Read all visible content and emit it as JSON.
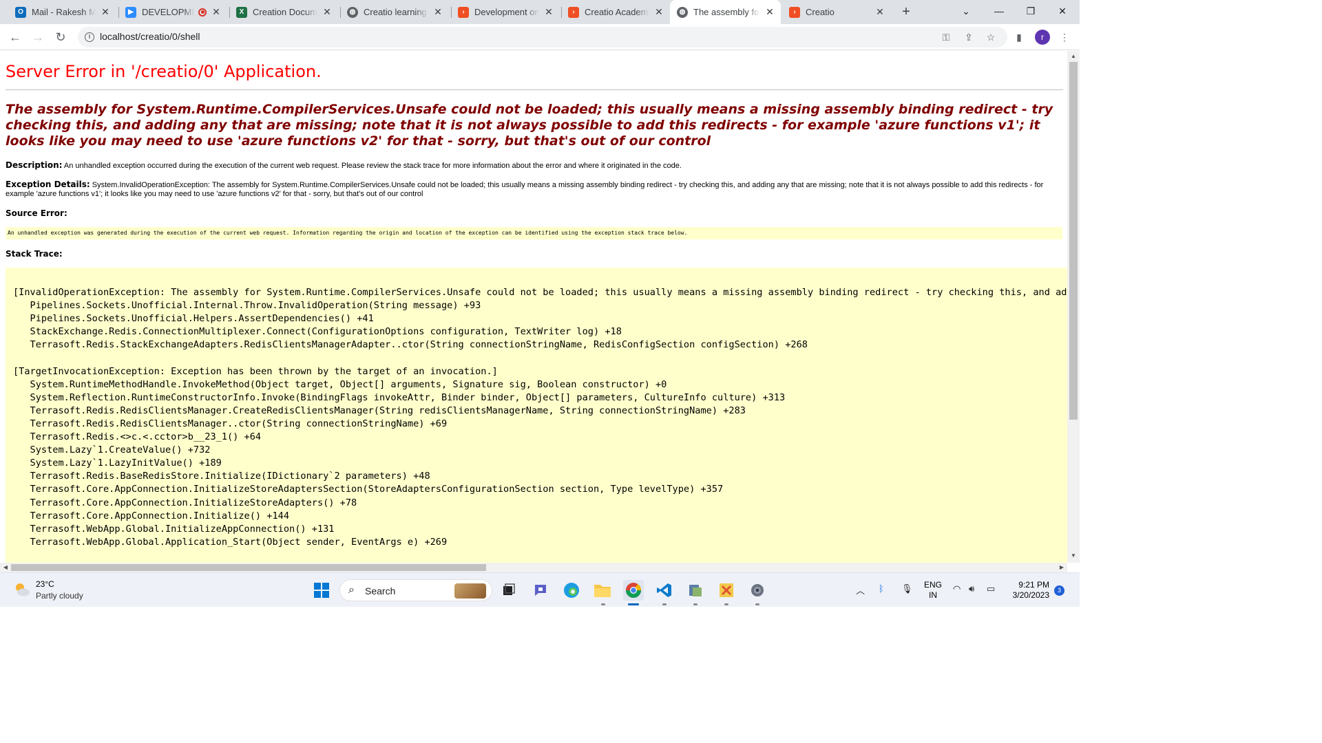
{
  "browser": {
    "tabs": [
      {
        "title": "Mail - Rakesh Mali - Outlook",
        "icon": "outlook-icon",
        "color": "#0f6cbd"
      },
      {
        "title": "DEVELOPMENT",
        "icon": "zoom-icon",
        "color": "#2d8cff",
        "recording": true
      },
      {
        "title": "Creation Document",
        "icon": "excel-icon",
        "color": "#1e7145"
      },
      {
        "title": "Creatio learning this",
        "icon": "globe-icon",
        "color": "#5f6368"
      },
      {
        "title": "Development on Creatio",
        "icon": "creatio-icon",
        "color": "#f04e23"
      },
      {
        "title": "Creatio Academy",
        "icon": "creatio-icon",
        "color": "#f04e23"
      },
      {
        "title": "The assembly for System",
        "icon": "globe-icon",
        "color": "#5f6368",
        "active": true
      },
      {
        "title": "Creatio",
        "icon": "creatio-icon",
        "color": "#f04e23"
      }
    ],
    "url": "localhost/creatio/0/shell",
    "profile_initial": "r"
  },
  "page": {
    "title": "Server Error in '/creatio/0' Application.",
    "error_message": "The assembly for System.Runtime.CompilerServices.Unsafe could not be loaded; this usually means a missing assembly binding redirect - try checking this, and adding any that are missing; note that it is not always possible to add this redirects - for example 'azure functions v1'; it looks like you may need to use 'azure functions v2' for that - sorry, but that's out of our control",
    "description_label": "Description:",
    "description_text": "An unhandled exception occurred during the execution of the current web request. Please review the stack trace for more information about the error and where it originated in the code.",
    "exception_label": "Exception Details:",
    "exception_text": "System.InvalidOperationException: The assembly for System.Runtime.CompilerServices.Unsafe could not be loaded; this usually means a missing assembly binding redirect - try checking this, and adding any that are missing; note that it is not always possible to add this redirects - for example 'azure functions v1'; it looks like you may need to use 'azure functions v2' for that - sorry, but that's out of our control",
    "source_error_label": "Source Error:",
    "source_error_text": "An unhandled exception was generated during the execution of the current web request. Information regarding the origin and location of the exception can be identified using the exception stack trace below.",
    "stack_trace_label": "Stack Trace:",
    "stack_trace": "[InvalidOperationException: The assembly for System.Runtime.CompilerServices.Unsafe could not be loaded; this usually means a missing assembly binding redirect - try checking this, and adding any that are missing; note that it is not always possible to add this redirects - for example 'azure functions v1'; it looks like you may need to use 'azure functions v2' for that - sorry, but that's out of our control]\n   Pipelines.Sockets.Unofficial.Internal.Throw.InvalidOperation(String message) +93\n   Pipelines.Sockets.Unofficial.Helpers.AssertDependencies() +41\n   StackExchange.Redis.ConnectionMultiplexer.Connect(ConfigurationOptions configuration, TextWriter log) +18\n   Terrasoft.Redis.StackExchangeAdapters.RedisClientsManagerAdapter..ctor(String connectionStringName, RedisConfigSection configSection) +268\n\n[TargetInvocationException: Exception has been thrown by the target of an invocation.]\n   System.RuntimeMethodHandle.InvokeMethod(Object target, Object[] arguments, Signature sig, Boolean constructor) +0\n   System.Reflection.RuntimeConstructorInfo.Invoke(BindingFlags invokeAttr, Binder binder, Object[] parameters, CultureInfo culture) +313\n   Terrasoft.Redis.RedisClientsManager.CreateRedisClientsManager(String redisClientsManagerName, String connectionStringName) +283\n   Terrasoft.Redis.RedisClientsManager..ctor(String connectionStringName) +69\n   Terrasoft.Redis.<>c.<.cctor>b__23_1() +64\n   System.Lazy`1.CreateValue() +732\n   System.Lazy`1.LazyInitValue() +189\n   Terrasoft.Redis.BaseRedisStore.Initialize(IDictionary`2 parameters) +48\n   Terrasoft.Core.AppConnection.InitializeStoreAdaptersSection(StoreAdaptersConfigurationSection section, Type levelType) +357\n   Terrasoft.Core.AppConnection.InitializeStoreAdapters() +78\n   Terrasoft.Core.AppConnection.Initialize() +144\n   Terrasoft.WebApp.Global.InitializeAppConnection() +131\n   Terrasoft.WebApp.Global.Application_Start(Object sender, EventArgs e) +269"
  },
  "taskbar": {
    "weather_temp": "23°C",
    "weather_desc": "Partly cloudy",
    "search_placeholder": "Search",
    "lang_line1": "ENG",
    "lang_line2": "IN",
    "time": "9:21 PM",
    "date": "3/20/2023",
    "notification_count": "3"
  }
}
